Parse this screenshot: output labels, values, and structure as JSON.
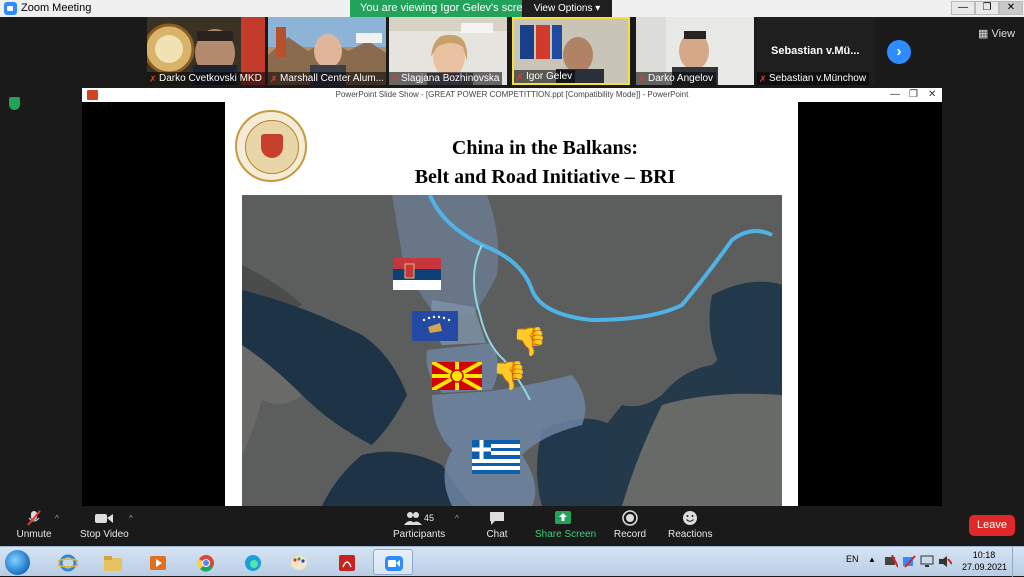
{
  "window": {
    "title": "Zoom Meeting",
    "minimize": "—",
    "maximize": "❐",
    "close": "✕"
  },
  "share_banner": {
    "message": "You are viewing Igor Gelev's screen",
    "view_options": "View Options ▾"
  },
  "participants_strip": [
    {
      "name": "Darko Cvetkovski MKD",
      "muted": true
    },
    {
      "name": "Marshall Center Alum...",
      "muted": true
    },
    {
      "name": "Slagjana Bozhinovska",
      "muted": true
    },
    {
      "name": "Igor Gelev",
      "muted": true
    },
    {
      "name": "Darko Angelov",
      "muted": true
    },
    {
      "name": "Sebastian v.Münchow",
      "muted": true,
      "display_text": "Sebastian  v.Mü..."
    }
  ],
  "view_button": "View",
  "next_arrow": "›",
  "powerpoint": {
    "window_title": "PowerPoint Slide Show - [GREAT POWER COMPETITTION.ppt [Compatibility Mode]] - PowerPoint",
    "minimize": "—",
    "restore": "❐",
    "close": "✕"
  },
  "slide": {
    "title_line1": "China in the Balkans:",
    "title_line2": "Belt and Road Initiative – BRI"
  },
  "map_markers": [
    {
      "label": "serbia-flag",
      "icon": "serbia-flag"
    },
    {
      "label": "kosovo-flag",
      "icon": "kosovo-flag"
    },
    {
      "label": "north-macedonia-flag",
      "icon": "north-macedonia-flag"
    },
    {
      "label": "greece-flag",
      "icon": "greece-flag"
    },
    {
      "label": "thumbs-down-1",
      "icon": "thumbs-down-icon"
    },
    {
      "label": "thumbs-down-2",
      "icon": "thumbs-down-icon"
    }
  ],
  "toolbar": {
    "unmute": "Unmute",
    "stop_video": "Stop Video",
    "participants": "Participants",
    "participants_count": "45",
    "chat": "Chat",
    "share_screen": "Share Screen",
    "record": "Record",
    "reactions": "Reactions",
    "leave": "Leave",
    "caret": "^"
  },
  "taskbar": {
    "language": "EN",
    "time": "10:18",
    "date": "27.09.2021",
    "apps": [
      "internet-explorer",
      "file-explorer",
      "media-player",
      "chrome",
      "edge",
      "paint",
      "acrobat-reader",
      "zoom"
    ]
  },
  "colors": {
    "zoom_blue": "#2d8cff",
    "share_green": "#23a25a",
    "leave_red": "#e02828",
    "muted_red": "#e53935",
    "river_blue": "#4fb3e8"
  }
}
